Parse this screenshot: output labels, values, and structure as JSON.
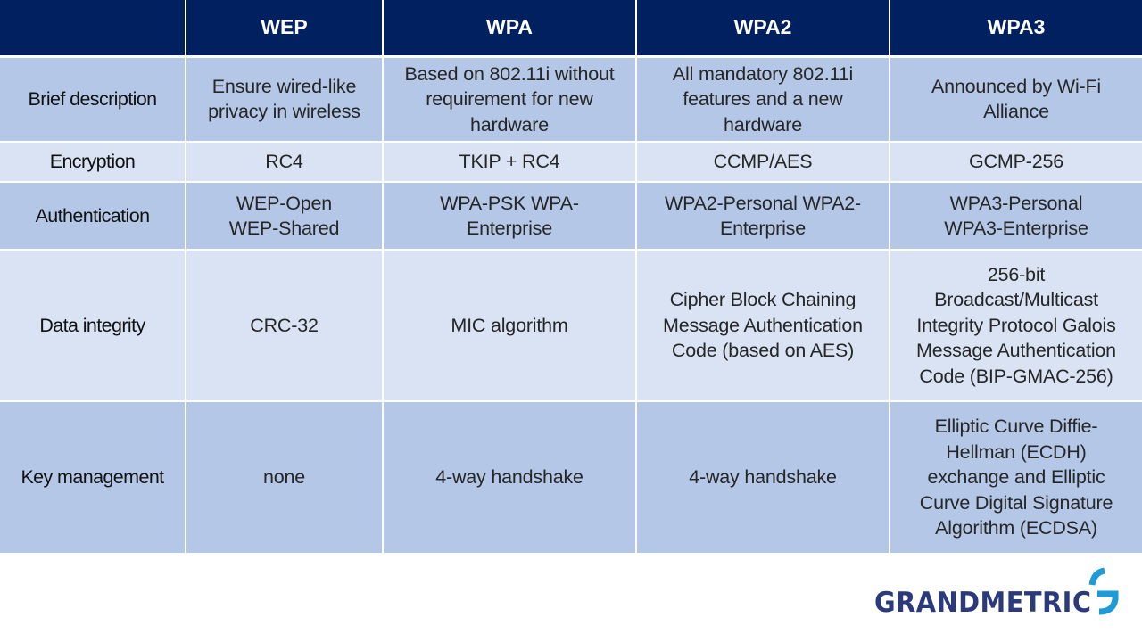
{
  "table": {
    "headers": [
      "",
      "WEP",
      "WPA",
      "WPA2",
      "WPA3"
    ],
    "rows": [
      {
        "label": "Brief description",
        "cells": [
          "Ensure wired-like privacy in wireless",
          "Based on 802.11i without requirement for new hardware",
          "All mandatory 802.11i features and a new hardware",
          "Announced by Wi-Fi Alliance"
        ]
      },
      {
        "label": "Encryption",
        "cells": [
          "RC4",
          "TKIP + RC4",
          "CCMP/AES",
          "GCMP-256"
        ]
      },
      {
        "label": "Authentication",
        "cells": [
          "WEP-Open WEP-Shared",
          "WPA-PSK WPA-Enterprise",
          "WPA2-Personal WPA2-Enterprise",
          "WPA3-Personal WPA3-Enterprise"
        ]
      },
      {
        "label": "Data integrity",
        "cells": [
          "CRC-32",
          "MIC algorithm",
          "Cipher Block Chaining Message Authentication Code (based on AES)",
          "256-bit Broadcast/Multicast Integrity Protocol Galois Message Authentication Code (BIP-GMAC-256)"
        ]
      },
      {
        "label": "Key management",
        "cells": [
          "none",
          "4-way handshake",
          "4-way handshake",
          "Elliptic Curve Diffie-Hellman (ECDH) exchange and Elliptic Curve Digital Signature Algorithm (ECDSA)"
        ]
      }
    ]
  },
  "logo": {
    "text": "GRANDMETRIC",
    "icon": "grandmetric-g-mark-icon",
    "text_color": "#2b3a7a",
    "mark_color": "#1e9ad6"
  },
  "colors": {
    "header_bg": "#002060",
    "row_dark": "#b4c7e7",
    "row_light": "#dae3f3"
  }
}
